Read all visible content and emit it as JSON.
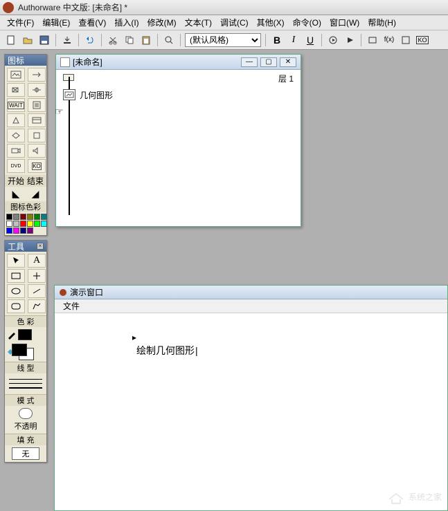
{
  "title": "Authorware 中文版: [未命名] *",
  "menu": [
    "文件(F)",
    "编辑(E)",
    "查看(V)",
    "插入(I)",
    "修改(M)",
    "文本(T)",
    "调试(C)",
    "其他(X)",
    "命令(O)",
    "窗口(W)",
    "帮助(H)"
  ],
  "toolbar": {
    "style_value": "(默认风格)",
    "bold": "B",
    "italic": "I",
    "underline": "U"
  },
  "panels": {
    "icons_title": "图标",
    "start_label": "开始",
    "end_label": "结束",
    "icon_color_label": "图标色彩",
    "tools_title": "工具",
    "color_section": "色 彩",
    "line_section": "线 型",
    "mode_section": "模 式",
    "mode_value": "不透明",
    "fill_section": "填 充",
    "fill_none": "无"
  },
  "colors": [
    "#000000",
    "#808080",
    "#800000",
    "#808000",
    "#008000",
    "#008080",
    "#000080",
    "#800080",
    "#ffffff",
    "#c0c0c0",
    "#ff0000",
    "#ffff00",
    "#00ff00",
    "#00ffff",
    "#0000ff",
    "#ff00ff"
  ],
  "design": {
    "title": "[未命名]",
    "layer_label": "层 1",
    "icon_label": "几何图形"
  },
  "presentation": {
    "title": "演示窗口",
    "menu_file": "文件",
    "canvas_text": "绘制几何图形"
  },
  "watermark": "系统之家"
}
